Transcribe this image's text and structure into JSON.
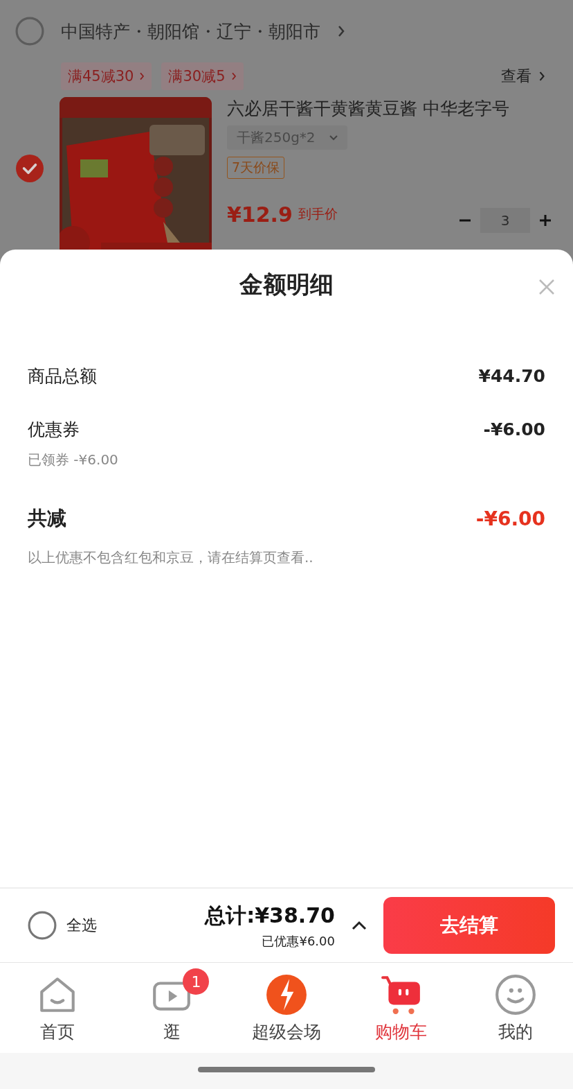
{
  "store": {
    "checked": false,
    "name": "中国特产・朝阳馆・辽宁・朝阳市",
    "promos": [
      "满45减30",
      "满30减5"
    ],
    "view_link": "查看"
  },
  "item": {
    "checked": true,
    "title": "六必居干酱干黄酱黄豆酱 中华老字号",
    "variant": "干酱250g*2",
    "tag": "7天价保",
    "price": "¥12.9",
    "price_note": "到手价",
    "quantity": "3"
  },
  "sheet": {
    "title": "金额明细",
    "rows": [
      {
        "kind": "line",
        "label": "商品总额",
        "value": "¥44.70"
      },
      {
        "kind": "line",
        "label": "优惠券",
        "value": "-¥6.00",
        "note": "已领券 -¥6.00"
      },
      {
        "kind": "total",
        "label": "共减",
        "value": "-¥6.00",
        "note": "以上优惠不包含红包和京豆，请在结算页查看.."
      }
    ]
  },
  "checkout_bar": {
    "select_all": {
      "label": "全选",
      "checked": false
    },
    "total": "总计:¥38.70",
    "saved": "已优惠¥6.00",
    "expanded": true,
    "button": "去结算"
  },
  "tab_bar": [
    {
      "kind": "home",
      "label": "首页",
      "selected": false
    },
    {
      "kind": "video",
      "label": "逛",
      "selected": false,
      "badge": "1"
    },
    {
      "kind": "deals",
      "label": "超级会场",
      "selected": false
    },
    {
      "kind": "cart",
      "label": "购物车",
      "selected": true
    },
    {
      "kind": "me",
      "label": "我的",
      "selected": false
    }
  ]
}
